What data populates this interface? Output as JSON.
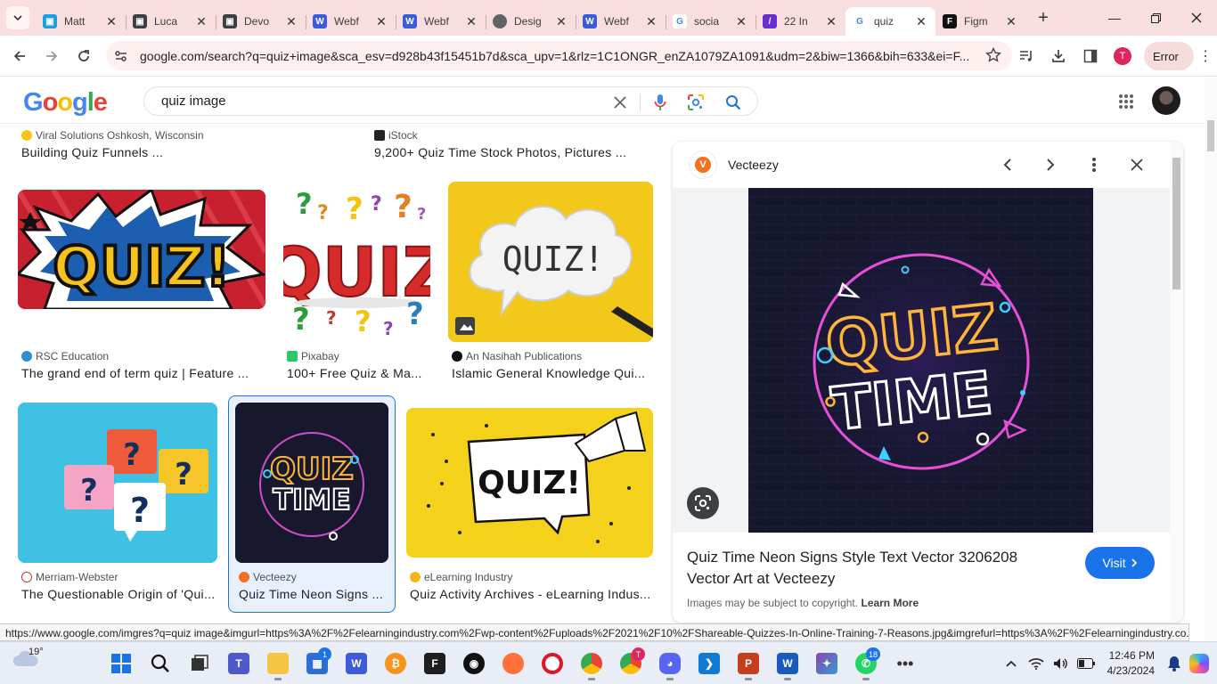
{
  "browser": {
    "tabs": [
      {
        "title": "Matt",
        "favicon_color": "#1ba1e2",
        "icon": "person-icon"
      },
      {
        "title": "Luca",
        "favicon_color": "#3c4043",
        "icon": "person-icon"
      },
      {
        "title": "Devo",
        "favicon_color": "#3c4043",
        "icon": "person-icon"
      },
      {
        "title": "Webf",
        "favicon_color": "#3b5bdb",
        "icon": "webflow-icon"
      },
      {
        "title": "Webf",
        "favicon_color": "#3b5bdb",
        "icon": "webflow-icon"
      },
      {
        "title": "Desig",
        "favicon_color": "#5f6368",
        "icon": "globe-icon"
      },
      {
        "title": "Webf",
        "favicon_color": "#3b5bdb",
        "icon": "webflow-icon"
      },
      {
        "title": "socia",
        "favicon_color": "#ffffff",
        "icon": "google-icon"
      },
      {
        "title": "22 In",
        "favicon_color": "#6a2fd1",
        "icon": "typeform-icon"
      },
      {
        "title": "quiz",
        "favicon_color": "#ffffff",
        "icon": "google-icon",
        "active": true
      },
      {
        "title": "Figm",
        "favicon_color": "#111111",
        "icon": "figma-icon"
      }
    ],
    "url": "google.com/search?q=quiz+image&sca_esv=d928b43f15451b7d&sca_upv=1&rlz=1C1ONGR_enZA1079ZA1091&udm=2&biw=1366&bih=633&ei=F...",
    "profile_initial": "T",
    "error_label": "Error",
    "status_url": "https://www.google.com/imgres?q=quiz image&imgurl=https%3A%2F%2Felearningindustry.com%2Fwp-content%2Fuploads%2F2021%2F10%2FShareable-Quizzes-In-Online-Training-7-Reasons.jpg&imgrefurl=https%3A%2F%2Felearningindustry.co..."
  },
  "google": {
    "logo": [
      "G",
      "o",
      "o",
      "g",
      "l",
      "e"
    ],
    "query": "quiz image"
  },
  "results": {
    "top_row": [
      {
        "source": "Viral Solutions Oshkosh, Wisconsin",
        "title": "Building Quiz Funnels ..."
      },
      {
        "source": "iStock",
        "title": "9,200+ Quiz Time Stock Photos, Pictures ..."
      }
    ],
    "row2": [
      {
        "source": "RSC Education",
        "title": "The grand end of term quiz | Feature ...",
        "image_text": "QUIZ!"
      },
      {
        "source": "Pixabay",
        "title": "100+ Free Quiz & Ma...",
        "image_text": "QUIZ"
      },
      {
        "source": "An Nasihah Publications",
        "title": "Islamic General Knowledge Qui...",
        "image_text": "QUIZ!"
      }
    ],
    "row3": [
      {
        "source": "Merriam-Webster",
        "title": "The Questionable Origin of 'Qui..."
      },
      {
        "source": "Vecteezy",
        "title": "Quiz Time Neon Signs ...",
        "image_text_1": "QUIZ",
        "image_text_2": "TIME"
      },
      {
        "source": "eLearning Industry",
        "title": "Quiz Activity Archives - eLearning Indus...",
        "image_text": "QUIZ!"
      }
    ]
  },
  "panel": {
    "site": "Vecteezy",
    "title": "Quiz Time Neon Signs Style Text Vector 3206208 Vector Art at Vecteezy",
    "visit_label": "Visit",
    "copyright": "Images may be subject to copyright.",
    "learn_more": "Learn More",
    "image_text_1": "QUIZ",
    "image_text_2": "TIME"
  },
  "taskbar": {
    "temperature": "19°",
    "time": "12:46 PM",
    "date": "4/23/2024",
    "store_badge": "1",
    "whatsapp_badge": "18",
    "chrome_profile": "T",
    "accent": "#1a73e8"
  }
}
